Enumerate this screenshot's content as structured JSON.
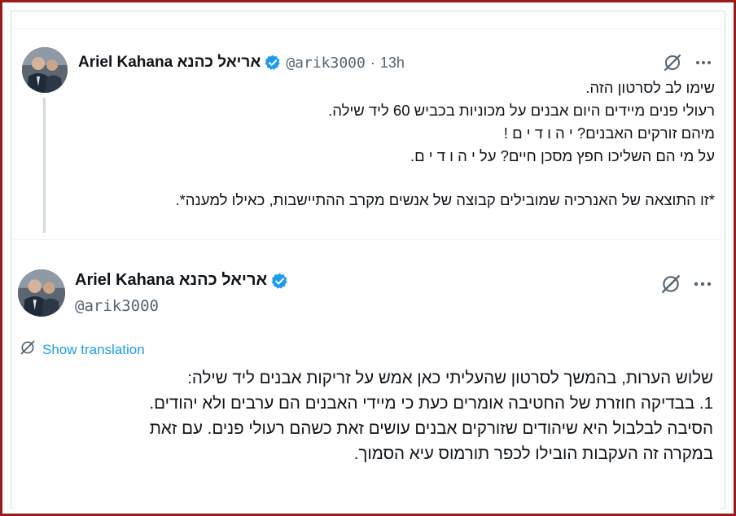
{
  "colors": {
    "frame_border": "#9b1b1b",
    "text": "#0f1419",
    "secondary": "#536471",
    "link": "#1d9bf0",
    "verified": "#1d9bf0"
  },
  "tweet1": {
    "author": {
      "display_name": "Ariel Kahana אריאל כהנא",
      "handle": "@arik3000",
      "separator": "·",
      "time": "13h",
      "avatar_icon": "avatar-photo",
      "verified_icon": "verified-badge-icon"
    },
    "grok_icon": "grok-icon",
    "more_icon": "more-options-icon",
    "lines": [
      "שימו לב לסרטון הזה.",
      "רעולי פנים מיידים היום אבנים על מכוניות בכביש 60 ליד שילה.",
      "מיהם זורקים האבנים? י ה ו ד י ם !",
      "על מי הם השליכו חפץ מסכן חיים? על י ה ו ד י ם.",
      "",
      "*זו התוצאה של האנרכיה שמובילים קבוצה של אנשים מקרב ההתיישבות, כאילו למענה*."
    ]
  },
  "tweet2": {
    "author": {
      "display_name": "Ariel Kahana אריאל כהנא",
      "handle": "@arik3000",
      "avatar_icon": "avatar-photo",
      "verified_icon": "verified-badge-icon"
    },
    "grok_icon": "grok-icon",
    "more_icon": "more-options-icon",
    "translate_label": "Show translation",
    "translate_icon": "translate-icon",
    "lines": [
      "שלוש הערות, בהמשך לסרטון שהעליתי כאן אמש על זריקות אבנים ליד שילה:",
      "1.  בבדיקה חוזרת של החטיבה אומרים כעת כי מיידי האבנים הם ערבים ולא יהודים.",
      "הסיבה לבלבול היא שיהודים שזורקים אבנים עושים זאת כשהם רעולי פנים. עם זאת",
      "במקרה זה העקבות הובילו לכפר תורמוס עיא הסמוך."
    ]
  }
}
